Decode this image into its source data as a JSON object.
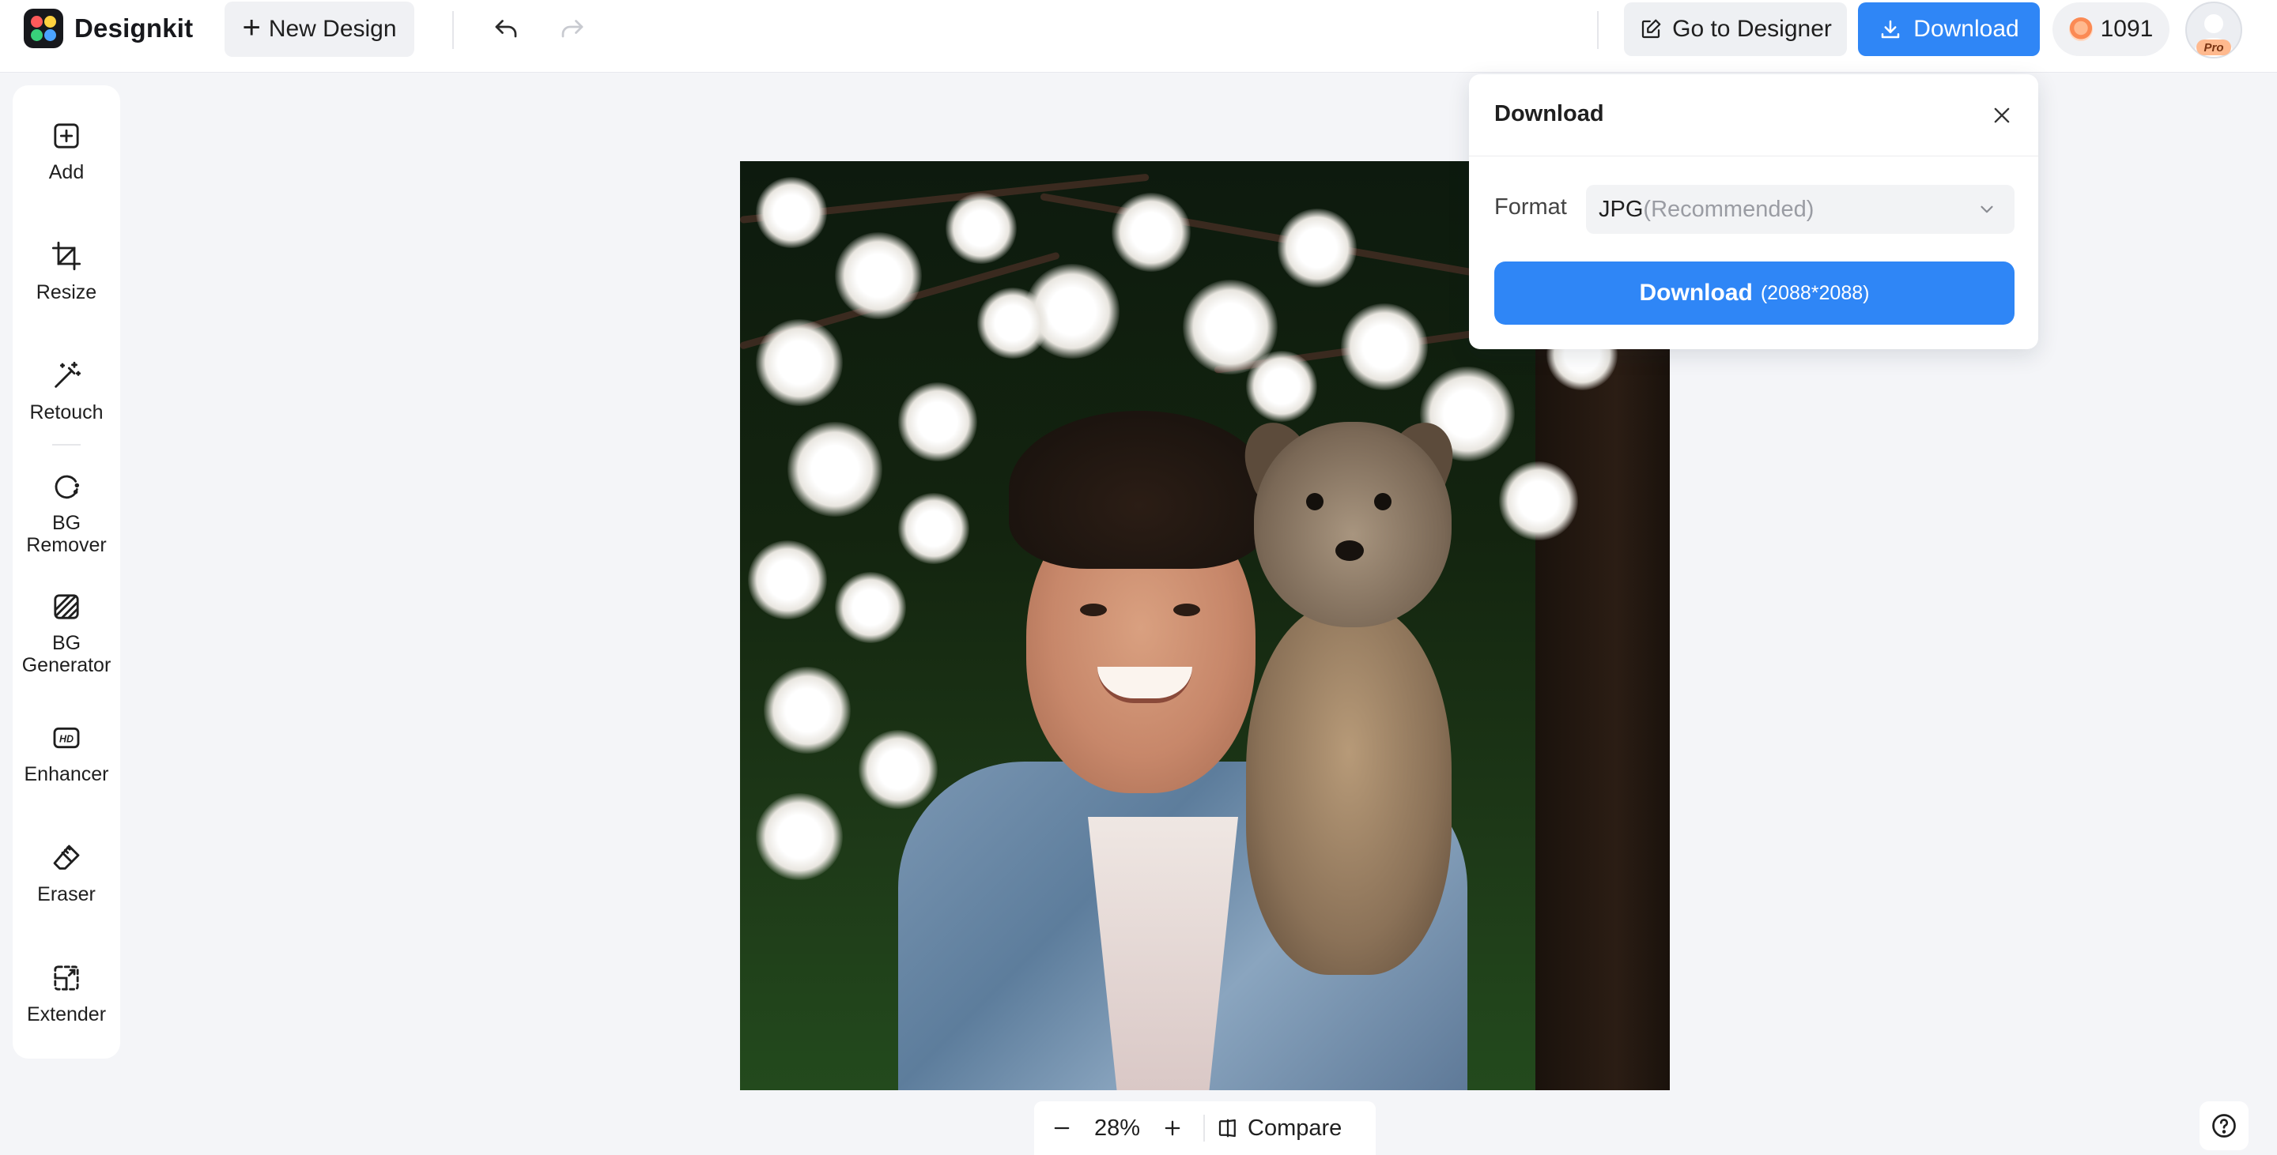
{
  "app": {
    "name": "Designkit"
  },
  "topbar": {
    "new_design_label": "New Design",
    "go_to_designer_label": "Go to Designer",
    "download_label": "Download",
    "credits": "1091",
    "avatar_badge": "Pro"
  },
  "sidebar": {
    "items": [
      {
        "label": "Add",
        "icon": "add-icon"
      },
      {
        "label": "Resize",
        "icon": "crop-icon"
      },
      {
        "label": "Retouch",
        "icon": "magic-wand-icon"
      },
      {
        "label": "BG Remover",
        "icon": "bg-remover-icon"
      },
      {
        "label": "BG Generator",
        "icon": "bg-generator-icon"
      },
      {
        "label": "Enhancer",
        "icon": "hd-icon"
      },
      {
        "label": "Eraser",
        "icon": "eraser-icon"
      },
      {
        "label": "Extender",
        "icon": "extender-icon"
      }
    ]
  },
  "zoom": {
    "value": "28%",
    "compare_label": "Compare"
  },
  "download_popup": {
    "title": "Download",
    "format_label": "Format",
    "format_value": "JPG",
    "format_hint": "(Recommended)",
    "button_label": "Download",
    "button_dimensions": "(2088*2088)"
  },
  "colors": {
    "accent": "#2f86f6",
    "background": "#f4f5f8"
  }
}
